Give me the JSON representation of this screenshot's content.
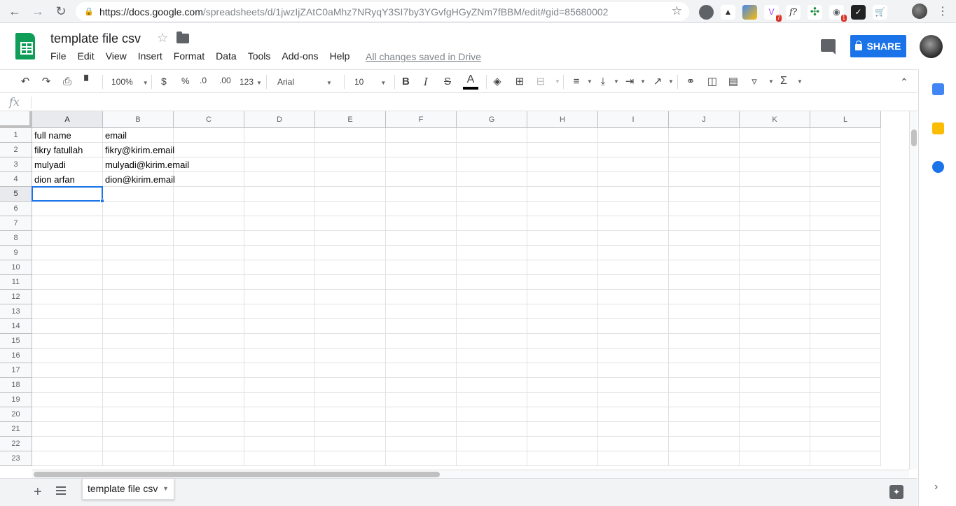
{
  "browser": {
    "url_host": "https://docs.google.com",
    "url_path": "/spreadsheets/d/1jwzIjZAtC0aMhz7NRyqY3SI7by3YGvfgHGyZNm7fBBM/edit#gid=85680002",
    "ext_badges": [
      "7",
      "1"
    ]
  },
  "doc": {
    "title": "template file csv",
    "menu": [
      "File",
      "Edit",
      "View",
      "Insert",
      "Format",
      "Data",
      "Tools",
      "Add-ons",
      "Help"
    ],
    "saved_status": "All changes saved in Drive",
    "share_label": "SHARE"
  },
  "toolbar": {
    "zoom": "100%",
    "currency": "$",
    "percent": "%",
    "decimal_decrease": ".0",
    "decimal_increase": ".00",
    "more_formats": "123",
    "font": "Arial",
    "font_size": "10",
    "bold": "B",
    "italic": "I",
    "strike": "S",
    "text_color": "A",
    "sum": "Σ"
  },
  "formula_bar": {
    "fx": "fx",
    "value": ""
  },
  "grid": {
    "columns": [
      "A",
      "B",
      "C",
      "D",
      "E",
      "F",
      "G",
      "H",
      "I",
      "J",
      "K",
      "L"
    ],
    "rows": [
      "1",
      "2",
      "3",
      "4",
      "5",
      "6",
      "7",
      "8",
      "9",
      "10",
      "11",
      "12",
      "13",
      "14",
      "15",
      "16",
      "17",
      "18",
      "19",
      "20",
      "21",
      "22",
      "23"
    ],
    "cells": [
      [
        "full name",
        "email"
      ],
      [
        "fikry fatullah",
        "fikry@kirim.email"
      ],
      [
        "mulyadi",
        "mulyadi@kirim.email"
      ],
      [
        "dion arfan",
        "dion@kirim.email"
      ]
    ],
    "selected_cell": "A5"
  },
  "sheets": {
    "tabs": [
      "template file csv"
    ]
  },
  "colors": {
    "accent": "#1a73e8",
    "sheets_green": "#0f9d58"
  }
}
